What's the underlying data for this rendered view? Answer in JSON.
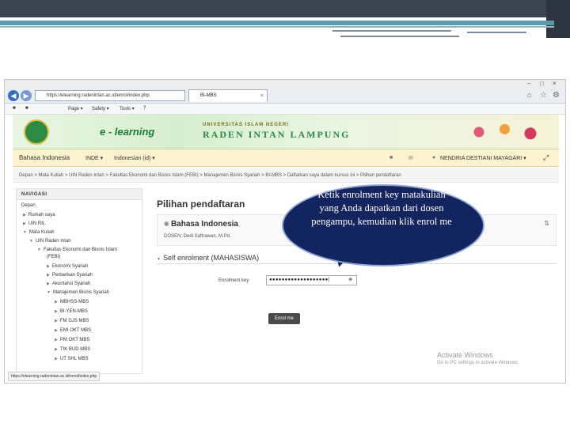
{
  "browser": {
    "url": "https://elearning.radenintan.ac.id/enrol/index.php",
    "tab_title": "BI-MBS",
    "tab_close": "×",
    "nav_back_icon": "back-arrow-icon",
    "nav_forward_icon": "forward-arrow-icon",
    "window_controls": [
      "–",
      "□",
      "×"
    ],
    "toolbar_items": [
      "Page ▾",
      "Safety ▾",
      "Tools ▾",
      "?"
    ],
    "status_url": "https://elearning.radenintan.ac.id/enrol/index.php"
  },
  "site": {
    "logo_text": "e - learning",
    "university_small": "UNIVERSITAS ISLAM NEGERI",
    "university_big": "RADEN INTAN LAMPUNG"
  },
  "menubar": {
    "language": "Bahasa Indonesia",
    "menu1": "INDE ▾",
    "lang_select": "Indonesian (id) ▾",
    "user_name": "NENDRIA DESTIANI MAYAGARI ▾"
  },
  "breadcrumb": "Depan > Mata Kuliah > UIN Raden Intan > Fakultas Ekonomi dan Bisnis Islam (FEBI) > Manajemen Bisnis Syariah > BI-MBS > Daftarkan saya dalam kursus ini > Pilihan pendaftaran",
  "navigation": {
    "title": "NAVIGASI",
    "items": [
      "Depan",
      "Rumah saya",
      "UIN RIL",
      "Mata Kuliah",
      "UIN Raden Intan",
      "Fakultas Ekonomi dan Bisnis Islam",
      "(FEBI)",
      "Ekonomi Syariah",
      "Perbankan Syariah",
      "Akuntansi Syariah",
      "Manajemen Bisnis Syariah",
      "MBHSS-MBS",
      "BI-YEN-MBS",
      "FM GJS MBS",
      "EMI OKT MBS",
      "PM OKT MBS",
      "TIK BUD MBS",
      "UT SHL MBS"
    ]
  },
  "main": {
    "title": "Pilihan pendaftaran",
    "course_name": "Bahasa Indonesia",
    "course_teacher": "DOSEN: Dedi Saftrawan, M.Pd.",
    "section_title": "Self enrolment (MAHASISWA)",
    "key_label": "Enrolment key",
    "key_value": "●●●●●●●●●●●●●●●●●●●|",
    "enrol_button": "Enrol me"
  },
  "watermark": {
    "line1": "Activate Windows",
    "line2": "Go to PC settings to activate Windows."
  },
  "callout": {
    "text": "Ketik enrolment key matakuliah yang Anda dapatkan dari dosen pengampu, kemudian klik enrol me"
  }
}
